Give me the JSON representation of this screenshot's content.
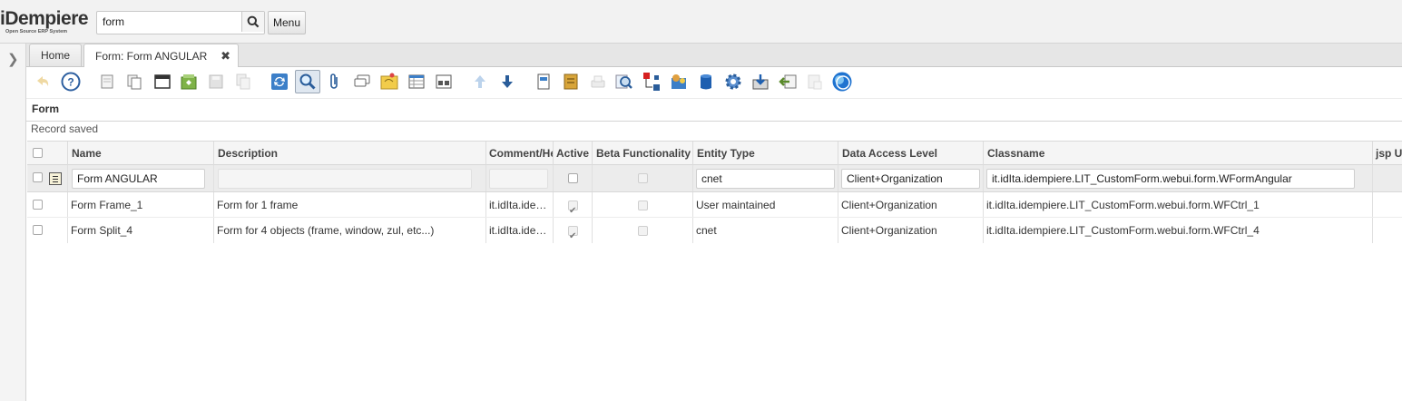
{
  "app": {
    "logo_text": "iDempiere",
    "logo_subtitle": "Open Source ERP System"
  },
  "header": {
    "search_value": "form",
    "menu_label": "Menu"
  },
  "tabs": [
    {
      "label": "Home"
    },
    {
      "label": "Form: Form ANGULAR",
      "close": "✖"
    }
  ],
  "toolbar_icons": [
    "undo-icon",
    "help-icon",
    "new-record-icon",
    "copy-record-icon",
    "toggle-grid-icon",
    "customize-icon",
    "save-icon",
    "delete-icon",
    "refresh-icon",
    "find-icon",
    "attachment-icon",
    "chat-icon",
    "post-it-icon",
    "grid-toggle-icon",
    "detail-view-icon",
    "previous-record-icon",
    "next-record-icon",
    "report-icon",
    "archive-icon",
    "print-icon",
    "zoom-across-icon",
    "active-workflows-icon",
    "requests-icon",
    "product-info-icon",
    "process-icon",
    "export-icon",
    "import-icon",
    "file-import-icon",
    "show-all-icon",
    "web-icon"
  ],
  "panel": {
    "title": "Form",
    "status": "Record saved"
  },
  "grid": {
    "columns": [
      "Name",
      "Description",
      "Comment/Help",
      "Active",
      "Beta Functionality",
      "Entity Type",
      "Data Access Level",
      "Classname",
      "jsp URL"
    ],
    "edit_row": {
      "name": "Form ANGULAR",
      "description": "",
      "comment": "",
      "active": false,
      "beta": false,
      "entity_type": "cnet",
      "data_access": "Client+Organization",
      "classname": "it.idIta.idempiere.LIT_CustomForm.webui.form.WFormAngular"
    },
    "rows": [
      {
        "name": "Form Frame_1",
        "description": "Form for 1 frame",
        "comment": "it.idIta.ide…",
        "active": true,
        "beta": false,
        "entity_type": "User maintained",
        "data_access": "Client+Organization",
        "classname": "it.idIta.idempiere.LIT_CustomForm.webui.form.WFCtrl_1"
      },
      {
        "name": "Form Split_4",
        "description": "Form for 4 objects (frame, window, zul, etc...)",
        "comment": "it.idIta.ide…",
        "active": true,
        "beta": false,
        "entity_type": "cnet",
        "data_access": "Client+Organization",
        "classname": "it.idIta.idempiere.LIT_CustomForm.webui.form.WFCtrl_4"
      }
    ]
  }
}
